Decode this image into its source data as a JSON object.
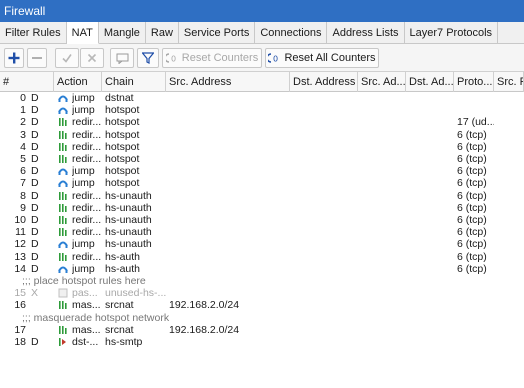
{
  "window": {
    "title": "Firewall"
  },
  "tabs": [
    {
      "label": "Filter Rules",
      "active": false
    },
    {
      "label": "NAT",
      "active": true
    },
    {
      "label": "Mangle",
      "active": false
    },
    {
      "label": "Raw",
      "active": false
    },
    {
      "label": "Service Ports",
      "active": false
    },
    {
      "label": "Connections",
      "active": false
    },
    {
      "label": "Address Lists",
      "active": false
    },
    {
      "label": "Layer7 Protocols",
      "active": false
    }
  ],
  "toolbar": {
    "add_icon": "plus-icon",
    "remove_icon": "minus-icon",
    "enable_icon": "check-icon",
    "disable_icon": "x-icon",
    "comment_icon": "comment-icon",
    "filter_icon": "filter-icon",
    "reset_counters_label": "Reset Counters",
    "reset_all_counters_label": "Reset All Counters"
  },
  "columns": [
    "#",
    "Action",
    "Chain",
    "Src. Address",
    "Dst. Address",
    "Src. Ad...",
    "Dst. Ad...",
    "Proto...",
    "Src. P"
  ],
  "rows": [
    {
      "type": "rule",
      "num": "0",
      "flag": "D",
      "action_icon": "jump",
      "action": "jump",
      "chain": "dstnat",
      "src": "",
      "proto": ""
    },
    {
      "type": "rule",
      "num": "1",
      "flag": "D",
      "action_icon": "jump",
      "action": "jump",
      "chain": "hotspot",
      "src": "",
      "proto": ""
    },
    {
      "type": "rule",
      "num": "2",
      "flag": "D",
      "action_icon": "redirect",
      "action": "redir...",
      "chain": "hotspot",
      "src": "",
      "proto": "17 (ud..."
    },
    {
      "type": "rule",
      "num": "3",
      "flag": "D",
      "action_icon": "redirect",
      "action": "redir...",
      "chain": "hotspot",
      "src": "",
      "proto": "6 (tcp)"
    },
    {
      "type": "rule",
      "num": "4",
      "flag": "D",
      "action_icon": "redirect",
      "action": "redir...",
      "chain": "hotspot",
      "src": "",
      "proto": "6 (tcp)"
    },
    {
      "type": "rule",
      "num": "5",
      "flag": "D",
      "action_icon": "redirect",
      "action": "redir...",
      "chain": "hotspot",
      "src": "",
      "proto": "6 (tcp)"
    },
    {
      "type": "rule",
      "num": "6",
      "flag": "D",
      "action_icon": "jump",
      "action": "jump",
      "chain": "hotspot",
      "src": "",
      "proto": "6 (tcp)"
    },
    {
      "type": "rule",
      "num": "7",
      "flag": "D",
      "action_icon": "jump",
      "action": "jump",
      "chain": "hotspot",
      "src": "",
      "proto": "6 (tcp)"
    },
    {
      "type": "rule",
      "num": "8",
      "flag": "D",
      "action_icon": "redirect",
      "action": "redir...",
      "chain": "hs-unauth",
      "src": "",
      "proto": "6 (tcp)"
    },
    {
      "type": "rule",
      "num": "9",
      "flag": "D",
      "action_icon": "redirect",
      "action": "redir...",
      "chain": "hs-unauth",
      "src": "",
      "proto": "6 (tcp)"
    },
    {
      "type": "rule",
      "num": "10",
      "flag": "D",
      "action_icon": "redirect",
      "action": "redir...",
      "chain": "hs-unauth",
      "src": "",
      "proto": "6 (tcp)"
    },
    {
      "type": "rule",
      "num": "11",
      "flag": "D",
      "action_icon": "redirect",
      "action": "redir...",
      "chain": "hs-unauth",
      "src": "",
      "proto": "6 (tcp)"
    },
    {
      "type": "rule",
      "num": "12",
      "flag": "D",
      "action_icon": "jump",
      "action": "jump",
      "chain": "hs-unauth",
      "src": "",
      "proto": "6 (tcp)"
    },
    {
      "type": "rule",
      "num": "13",
      "flag": "D",
      "action_icon": "redirect",
      "action": "redir...",
      "chain": "hs-auth",
      "src": "",
      "proto": "6 (tcp)"
    },
    {
      "type": "rule",
      "num": "14",
      "flag": "D",
      "action_icon": "jump",
      "action": "jump",
      "chain": "hs-auth",
      "src": "",
      "proto": "6 (tcp)"
    },
    {
      "type": "comment",
      "text": ";;; place hotspot rules here"
    },
    {
      "type": "rule",
      "disabled": true,
      "num": "15",
      "flag": "X",
      "action_icon": "passthrough",
      "action": "pas...",
      "chain": "unused-hs-...",
      "src": "",
      "proto": ""
    },
    {
      "type": "rule",
      "num": "16",
      "flag": "",
      "action_icon": "masquerade",
      "action": "mas...",
      "chain": "srcnat",
      "src": "192.168.2.0/24",
      "proto": ""
    },
    {
      "type": "comment",
      "text": ";;; masquerade hotspot network"
    },
    {
      "type": "rule",
      "num": "17",
      "flag": "",
      "action_icon": "masquerade",
      "action": "mas...",
      "chain": "srcnat",
      "src": "192.168.2.0/24",
      "proto": ""
    },
    {
      "type": "rule",
      "num": "18",
      "flag": "D",
      "action_icon": "dst-nat",
      "action": "dst-...",
      "chain": "hs-smtp",
      "src": "",
      "proto": ""
    }
  ],
  "colors": {
    "titlebar": "#2f6fc3",
    "add_blue": "#1f4ea8",
    "jump_blue": "#2a7fd4",
    "redirect_green": "#2e9b3a"
  }
}
